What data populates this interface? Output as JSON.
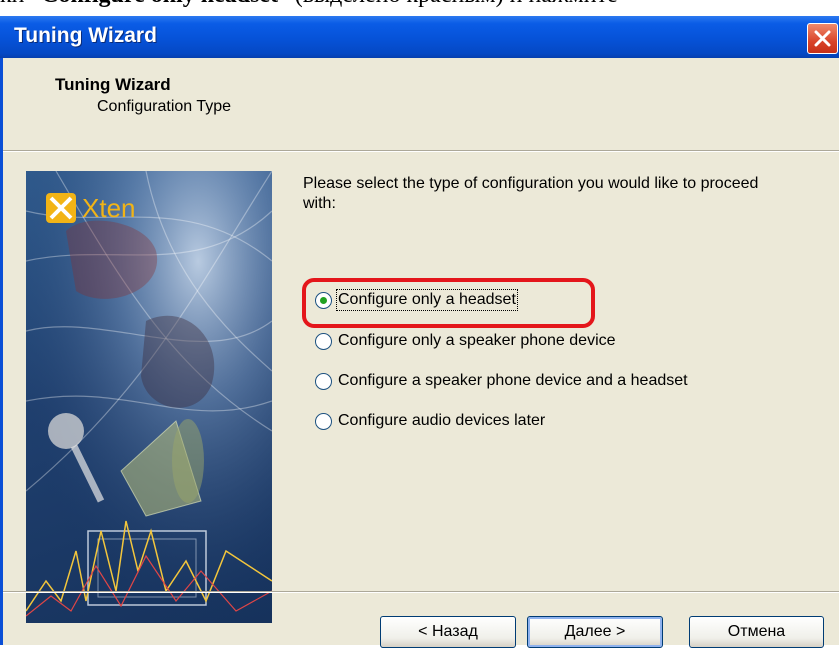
{
  "doc_caption": {
    "prefix": "кн “",
    "bold": "Configure only headset",
    "suffix": "” (выделено красным) и нажмите"
  },
  "window": {
    "title": "Tuning Wizard",
    "close_icon": "close-icon"
  },
  "header": {
    "title": "Tuning Wizard",
    "subtitle": "Configuration Type"
  },
  "brand": {
    "logo_text": "Xten"
  },
  "prompt": "Please select the type of configuration you would like to proceed with:",
  "options": [
    {
      "label": "Configure only a headset",
      "checked": true
    },
    {
      "label": "Configure only a speaker phone device",
      "checked": false
    },
    {
      "label": "Configure a speaker phone device and a headset",
      "checked": false
    },
    {
      "label": "Configure audio devices later",
      "checked": false
    }
  ],
  "buttons": {
    "back": "< Назад",
    "next": "Далее >",
    "cancel": "Отмена"
  },
  "colors": {
    "titlebar": "#0652d8",
    "highlight": "#e4161b",
    "radio_dot": "#21a121"
  }
}
